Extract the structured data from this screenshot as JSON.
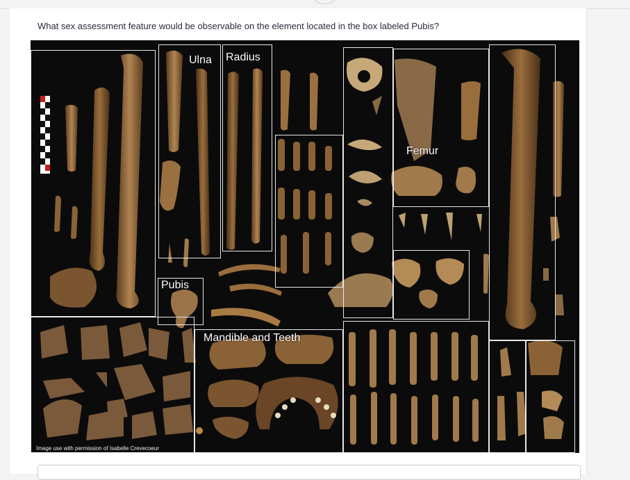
{
  "question": {
    "text": "What sex assessment feature would be observable on the element located in the box labeled Pubis?"
  },
  "figure": {
    "labels": {
      "ulna": "Ulna",
      "radius": "Radius",
      "femur": "Femur",
      "pubis": "Pubis",
      "mandible": "Mandible and Teeth"
    },
    "credit": "Image use with permission of Isabelle Crevecoeur"
  },
  "colors": {
    "bone_dark": "#5a3e22",
    "bone_mid": "#8a6236",
    "bone_light": "#b48a56",
    "background": "#0b0b0b",
    "box_border": "#e8e8e8"
  },
  "answer": {
    "value": ""
  }
}
